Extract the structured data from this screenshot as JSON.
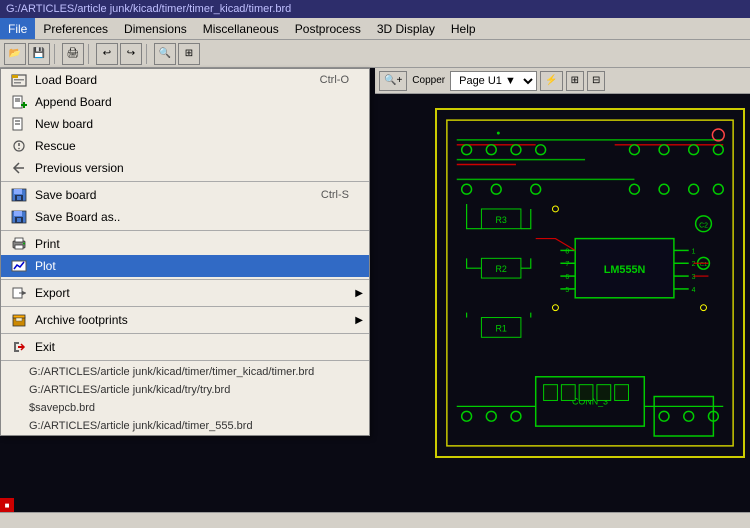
{
  "title_bar": {
    "text": "G:/ARTICLES/article junk/kicad/timer/timer_kicad/timer.brd"
  },
  "menu_bar": {
    "items": [
      {
        "label": "File",
        "active": true
      },
      {
        "label": "Preferences",
        "active": false
      },
      {
        "label": "Dimensions",
        "active": false
      },
      {
        "label": "Miscellaneous",
        "active": false
      },
      {
        "label": "Postprocess",
        "active": false
      },
      {
        "label": "3D Display",
        "active": false
      },
      {
        "label": "Help",
        "active": false
      }
    ]
  },
  "dropdown": {
    "items": [
      {
        "icon": "📋",
        "label": "Load Board",
        "shortcut": "Ctrl-O",
        "has_arrow": false
      },
      {
        "icon": "📎",
        "label": "Append Board",
        "shortcut": "",
        "has_arrow": false
      },
      {
        "icon": "📄",
        "label": "New board",
        "shortcut": "",
        "has_arrow": false
      },
      {
        "icon": "🔧",
        "label": "Rescue",
        "shortcut": "",
        "has_arrow": false
      },
      {
        "icon": "🔙",
        "label": "Previous version",
        "shortcut": "",
        "has_arrow": false
      },
      {
        "divider": true
      },
      {
        "icon": "💾",
        "label": "Save board",
        "shortcut": "Ctrl-S",
        "has_arrow": false
      },
      {
        "icon": "💾",
        "label": "Save Board as..",
        "shortcut": "",
        "has_arrow": false
      },
      {
        "divider": true
      },
      {
        "icon": "🖨",
        "label": "Print",
        "shortcut": "",
        "has_arrow": false
      },
      {
        "icon": "📊",
        "label": "Plot",
        "shortcut": "",
        "highlighted": true,
        "has_arrow": false
      },
      {
        "divider": true
      },
      {
        "icon": "📤",
        "label": "Export",
        "shortcut": "",
        "has_arrow": true
      },
      {
        "divider": true
      },
      {
        "icon": "📦",
        "label": "Archive footprints",
        "shortcut": "",
        "has_arrow": true
      },
      {
        "divider": true
      },
      {
        "icon": "🚪",
        "label": "Exit",
        "shortcut": "",
        "has_arrow": false
      }
    ],
    "recent_files": [
      "G:/ARTICLES/article junk/kicad/timer/timer_kicad/timer.brd",
      "G:/ARTICLES/article junk/kicad/try/try.brd",
      "$savepcb.brd",
      "G:/ARTICLES/article junk/kicad/timer_555.brd"
    ]
  },
  "pcb_toolbar": {
    "layer_label": "Copper",
    "page_label": "Page U1 ▼"
  },
  "status_bar": {
    "text": ""
  }
}
